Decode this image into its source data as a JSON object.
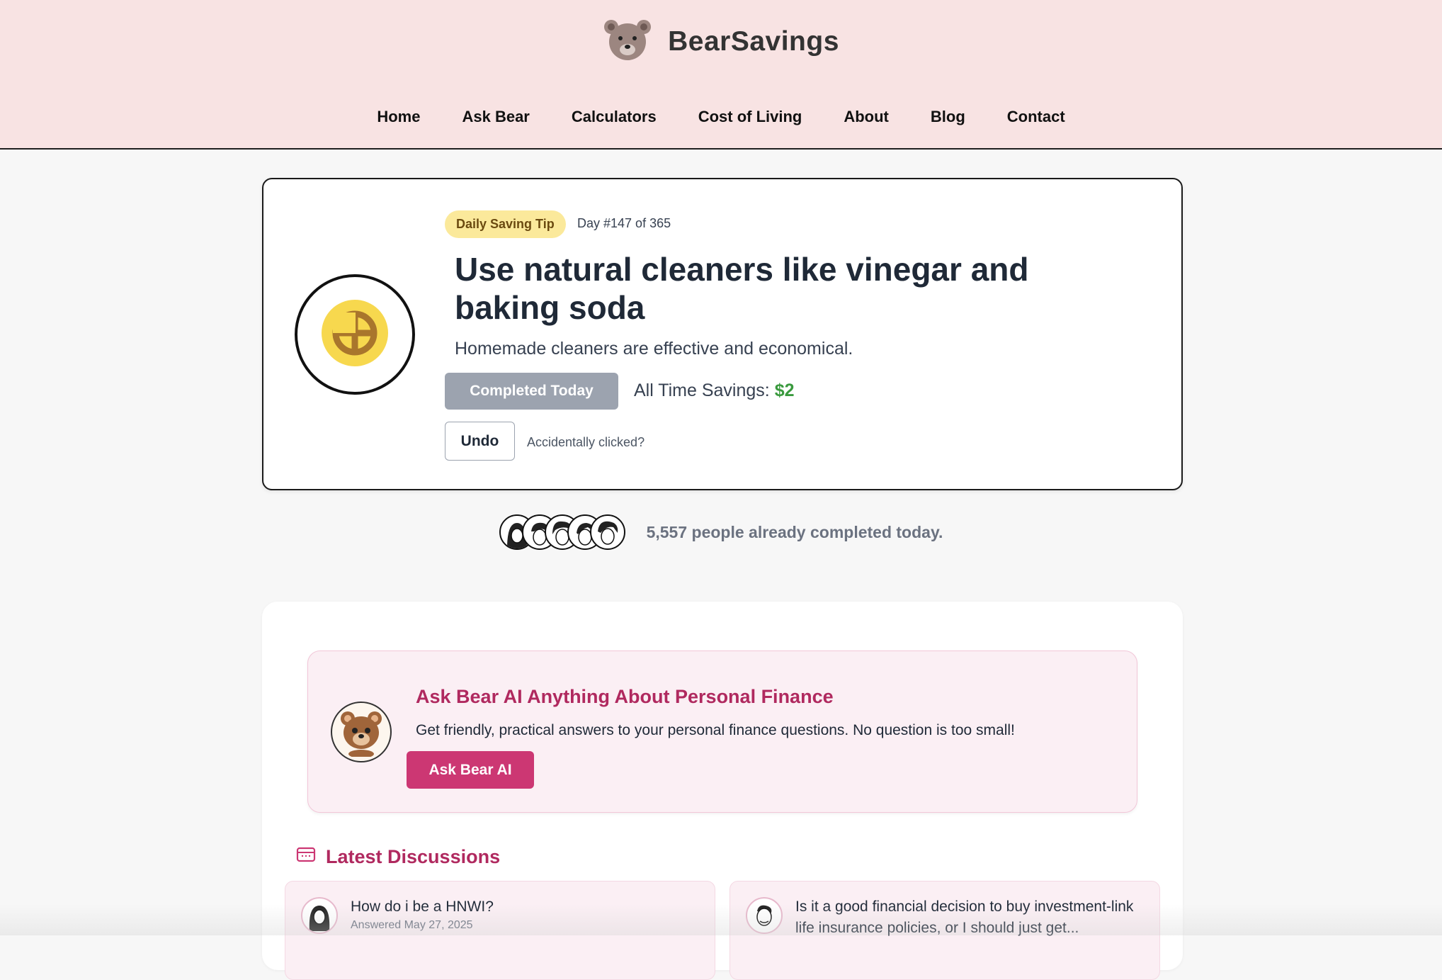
{
  "site": {
    "name": "BearSavings",
    "logo_icon": "bear-face-icon"
  },
  "nav": [
    {
      "label": "Home"
    },
    {
      "label": "Ask Bear"
    },
    {
      "label": "Calculators"
    },
    {
      "label": "Cost of Living"
    },
    {
      "label": "About"
    },
    {
      "label": "Blog"
    },
    {
      "label": "Contact"
    }
  ],
  "tip": {
    "icon": "coin-icon",
    "badge": "Daily Saving Tip",
    "day": "Day #147 of 365",
    "title": "Use natural cleaners like vinegar and baking soda",
    "description": "Homemade cleaners are effective and economical.",
    "completed_label": "Completed Today",
    "savings_label": "All Time Savings:",
    "savings_amount": "$2",
    "undo_label": "Undo",
    "undo_hint": "Accidentally clicked?"
  },
  "social_proof": {
    "text": "5,557 people already completed today.",
    "avatar_count": 5
  },
  "ask_bear": {
    "title": "Ask Bear AI Anything About Personal Finance",
    "description": "Get friendly, practical answers to your personal finance questions. No question is too small!",
    "button_label": "Ask Bear AI"
  },
  "discussions": {
    "title": "Latest Discussions",
    "icon": "chat-icon",
    "items": [
      {
        "question": "How do i be a HNWI?",
        "date": "Answered May 27, 2025"
      },
      {
        "question": "Is it a good financial decision to buy investment-link life insurance policies, or I should just get...",
        "date": ""
      }
    ]
  },
  "colors": {
    "header_bg": "#f8e3e3",
    "accent": "#cc3773",
    "heading_pink": "#b0295f",
    "badge_yellow": "#fbe99b",
    "savings_green": "#3a9a3e"
  }
}
